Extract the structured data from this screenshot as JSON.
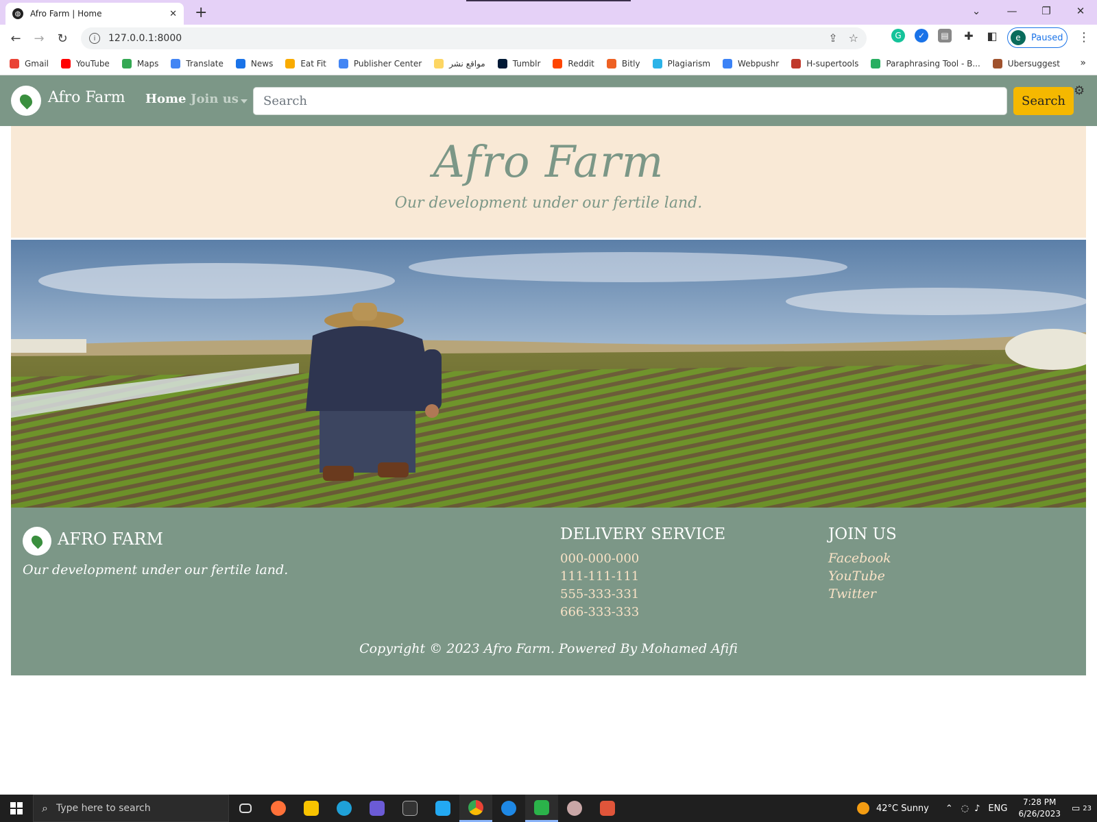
{
  "browser": {
    "tab_title": "Afro Farm | Home",
    "url": "127.0.0.1:8000",
    "profile_initial": "e",
    "profile_status": "Paused",
    "bookmarks": [
      {
        "label": "Gmail",
        "color": "#ea4335"
      },
      {
        "label": "YouTube",
        "color": "#ff0000"
      },
      {
        "label": "Maps",
        "color": "#34a853"
      },
      {
        "label": "Translate",
        "color": "#4285f4"
      },
      {
        "label": "News",
        "color": "#1a73e8"
      },
      {
        "label": "Eat Fit",
        "color": "#f9ab00"
      },
      {
        "label": "Publisher Center",
        "color": "#4285f4"
      },
      {
        "label": "مواقع نشر",
        "color": "#fdd663"
      },
      {
        "label": "Tumblr",
        "color": "#001935"
      },
      {
        "label": "Reddit",
        "color": "#ff4500"
      },
      {
        "label": "Bitly",
        "color": "#ee6123"
      },
      {
        "label": "Plagiarism",
        "color": "#2bb3e8"
      },
      {
        "label": "Webpushr",
        "color": "#3b82f6"
      },
      {
        "label": "H-supertools",
        "color": "#c0392b"
      },
      {
        "label": "Paraphrasing Tool - B...",
        "color": "#27ae60"
      },
      {
        "label": "Ubersuggest",
        "color": "#a0522d"
      }
    ],
    "bookmarks_more": "»"
  },
  "site": {
    "brand": "Afro Farm",
    "nav": {
      "home": "Home",
      "join": "Join us"
    },
    "search": {
      "placeholder": "Search",
      "button": "Search"
    },
    "hero": {
      "title": "Afro Farm",
      "subtitle": "Our development under our fertile land."
    },
    "footer": {
      "brand": "AFRO FARM",
      "tagline": "Our development under our fertile land.",
      "delivery_heading": "DELIVERY SERVICE",
      "phones": [
        "000-000-000",
        "111-111-111",
        "555-333-331",
        "666-333-333"
      ],
      "join_heading": "JOIN US",
      "social": [
        "Facebook",
        "YouTube",
        "Twitter"
      ],
      "copyright": "Copyright © 2023 Afro Farm. Powered By Mohamed Afifi"
    },
    "colors": {
      "nav": "#7c9787",
      "hero_bg": "#f9e9d6",
      "accent": "#f5b800"
    }
  },
  "taskbar": {
    "search_placeholder": "Type here to search",
    "weather": "42°C  Sunny",
    "lang": "ENG",
    "time": "7:28 PM",
    "date": "6/26/2023",
    "notifications": "23"
  }
}
